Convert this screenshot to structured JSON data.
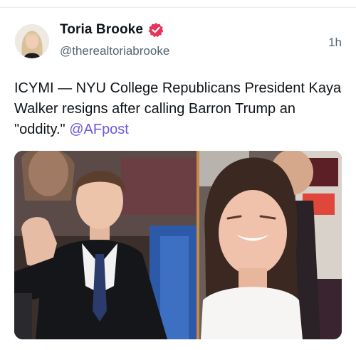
{
  "post": {
    "author_name": "Toria Brooke",
    "author_handle": "@therealtoriabrooke",
    "timestamp": "1h",
    "body_text": "ICYMI — NYU College Republicans President Kaya Walker resigns after calling Barron Trump an \"oddity.\" ",
    "mention": "@AFpost"
  },
  "media": {
    "images": [
      {
        "name": "left-photo"
      },
      {
        "name": "right-photo"
      }
    ]
  },
  "icons": {
    "verified": "verified-badge-icon"
  },
  "colors": {
    "verified_badge": "#e7355a",
    "mention": "#6a5ae0",
    "secondary_text": "#536471"
  }
}
